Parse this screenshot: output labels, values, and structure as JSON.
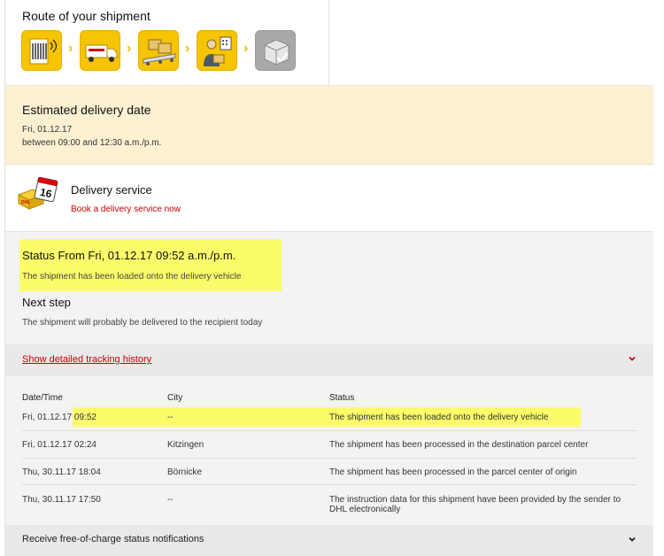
{
  "route": {
    "title": "Route of your shipment",
    "steps": [
      {
        "icon": "barcode-scan-icon",
        "state": "done"
      },
      {
        "icon": "truck-icon",
        "state": "done"
      },
      {
        "icon": "parcel-conveyor-icon",
        "state": "done"
      },
      {
        "icon": "courier-icon",
        "state": "done"
      },
      {
        "icon": "delivered-box-icon",
        "state": "pending"
      }
    ],
    "colors": {
      "done": "#f6c400",
      "pending": "#a9a9a9"
    }
  },
  "estimate": {
    "title": "Estimated delivery date",
    "date": "Fri, 01.12.17",
    "window": "between 09:00 and 12:30 a.m./p.m."
  },
  "service": {
    "title": "Delivery service",
    "link": "Book a delivery service now"
  },
  "status": {
    "title": "Status From Fri, 01.12.17 09:52 a.m./p.m.",
    "text": "The shipment has been loaded onto the delivery vehicle",
    "next_title": "Next step",
    "next_text": "The shipment will probably be delivered to the recipient today"
  },
  "history": {
    "toggle_label": "Show detailed tracking history",
    "columns": [
      "Date/Time",
      "City",
      "Status"
    ],
    "rows": [
      {
        "date": "Fri, 01.12.17 09:52",
        "city": "--",
        "status": "The shipment has been loaded onto the delivery vehicle"
      },
      {
        "date": "Fri, 01.12.17 02:24",
        "city": "Kitzingen",
        "status": "The shipment has been processed in the destination parcel center"
      },
      {
        "date": "Thu, 30.11.17 18:04",
        "city": "Börnicke",
        "status": "The shipment has been processed in the parcel center of origin"
      },
      {
        "date": "Thu, 30.11.17 17:50",
        "city": "--",
        "status": "The instruction data for this shipment have been provided by the sender to DHL electronically"
      }
    ]
  },
  "notifications": {
    "label": "Receive free-of-charge status notifications"
  },
  "colors": {
    "accent": "#cc0000",
    "highlight": "#fcfc6a",
    "estimate_bg": "#fdf1d2"
  }
}
